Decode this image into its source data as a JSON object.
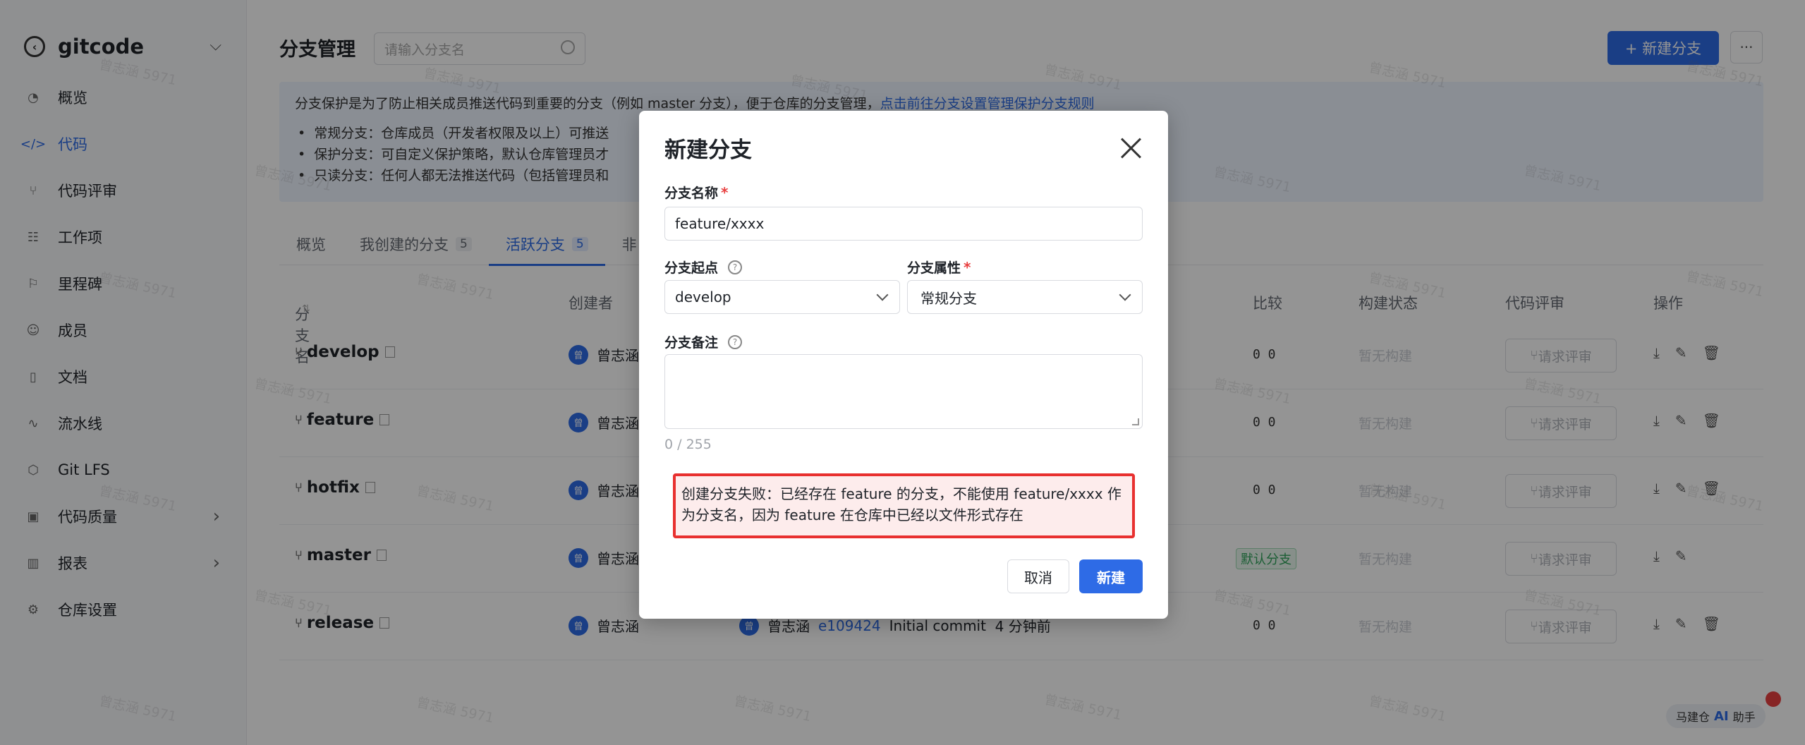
{
  "sidebar": {
    "title": "gitcode",
    "items": [
      {
        "label": "概览",
        "icon": "gauge-icon"
      },
      {
        "label": "代码",
        "icon": "code-icon"
      },
      {
        "label": "代码评审",
        "icon": "pull-request-icon"
      },
      {
        "label": "工作项",
        "icon": "checklist-icon"
      },
      {
        "label": "里程碑",
        "icon": "milestone-icon"
      },
      {
        "label": "成员",
        "icon": "user-icon"
      },
      {
        "label": "文档",
        "icon": "book-icon"
      },
      {
        "label": "流水线",
        "icon": "pipeline-icon"
      },
      {
        "label": "Git LFS",
        "icon": "cube-icon"
      },
      {
        "label": "代码质量",
        "icon": "quality-icon"
      },
      {
        "label": "报表",
        "icon": "bar-chart-icon"
      },
      {
        "label": "仓库设置",
        "icon": "gear-icon"
      }
    ]
  },
  "header": {
    "title": "分支管理",
    "search_placeholder": "请输入分支名",
    "new_branch_button": "+ 新建分支",
    "more_button": "···"
  },
  "notice": {
    "text": "分支保护是为了防止相关成员推送代码到重要的分支（例如 master 分支），便于仓库的分支管理，",
    "link": "点击前往分支设置管理保护分支规则",
    "bullets": [
      "常规分支：仓库成员（开发者权限及以上）可推送",
      "保护分支：可自定义保护策略，默认仓库管理员才",
      "只读分支：任何人都无法推送代码（包括管理员和"
    ]
  },
  "tabs": [
    {
      "label": "概览",
      "count": ""
    },
    {
      "label": "我创建的分支",
      "count": "5"
    },
    {
      "label": "活跃分支",
      "count": "5"
    },
    {
      "label": "非",
      "count": ""
    }
  ],
  "table": {
    "headers": {
      "name": "分支名",
      "creator": "创建者",
      "compare": "比较",
      "build": "构建状态",
      "review": "代码评审",
      "ops": "操作"
    },
    "rows": [
      {
        "name": "develop",
        "creator": "曾志涵",
        "compare": "0  0",
        "build": "暂无构建",
        "review": "请求评审"
      },
      {
        "name": "feature",
        "creator": "曾志涵",
        "compare": "0  0",
        "build": "暂无构建",
        "review": "请求评审"
      },
      {
        "name": "hotfix",
        "creator": "曾志涵",
        "compare": "0  0",
        "build": "暂无构建",
        "review": "请求评审"
      },
      {
        "name": "master",
        "creator": "曾志涵",
        "compare": "默认分支",
        "build": "暂无构建",
        "review": "请求评审"
      },
      {
        "name": "release",
        "creator": "曾志涵",
        "commit_author": "曾志涵",
        "commit_hash": "e109424",
        "commit_msg": "Initial commit",
        "commit_time": "4 分钟前",
        "compare": "0  0",
        "build": "暂无构建",
        "review": "请求评审"
      }
    ]
  },
  "watermark": "曾志涵 5971",
  "assistant": {
    "prefix": "马建仓",
    "ai": "AI",
    "suffix": "助手"
  },
  "modal": {
    "title": "新建分支",
    "branch_name_label": "分支名称",
    "branch_name_value": "feature/xxxx",
    "start_point_label": "分支起点",
    "start_point_value": "develop",
    "attribute_label": "分支属性",
    "attribute_value": "常规分支",
    "remark_label": "分支备注",
    "remark_counter": "0 / 255",
    "error_message": "创建分支失败：已经存在 feature 的分支，不能使用 feature/xxxx 作为分支名，因为 feature 在仓库中已经以文件形式存在",
    "cancel_button": "取消",
    "create_button": "新建"
  },
  "colors": {
    "accent": "#2e6be6",
    "error_border": "#e8302f",
    "error_bg": "#fdecec"
  }
}
